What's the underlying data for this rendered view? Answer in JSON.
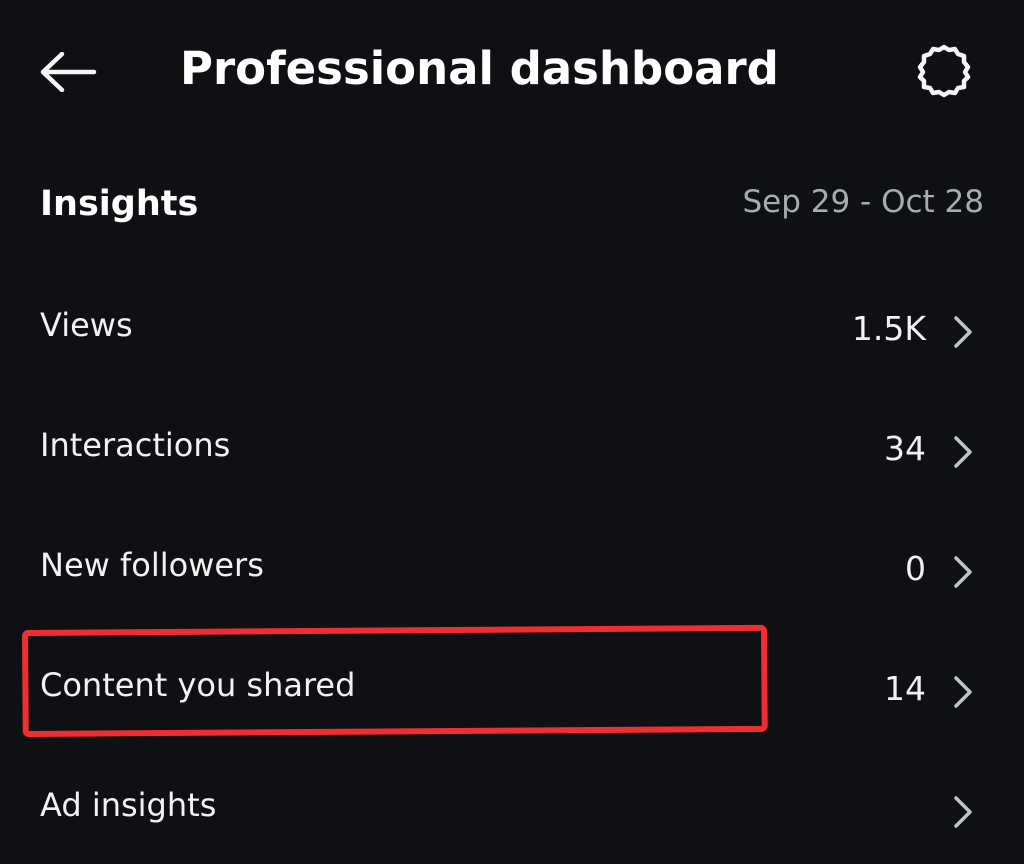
{
  "header": {
    "back_icon": "arrow-left-icon",
    "title": "Professional dashboard",
    "settings_icon": "gear-icon"
  },
  "insights": {
    "title": "Insights",
    "date_range": "Sep 29 - Oct 28",
    "rows": [
      {
        "label": "Views",
        "value": "1.5K",
        "icon": "chevron-right-icon"
      },
      {
        "label": "Interactions",
        "value": "34",
        "icon": "chevron-right-icon"
      },
      {
        "label": "New followers",
        "value": "0",
        "icon": "chevron-right-icon"
      },
      {
        "label": "Content you shared",
        "value": "14",
        "icon": "chevron-right-icon",
        "highlighted": true
      },
      {
        "label": "Ad insights",
        "value": "",
        "icon": "chevron-right-icon"
      }
    ]
  },
  "colors": {
    "background": "#0e1014",
    "text_primary": "#f5f5f5",
    "text_secondary": "#a8abb2",
    "highlight": "#ef2f2f"
  }
}
